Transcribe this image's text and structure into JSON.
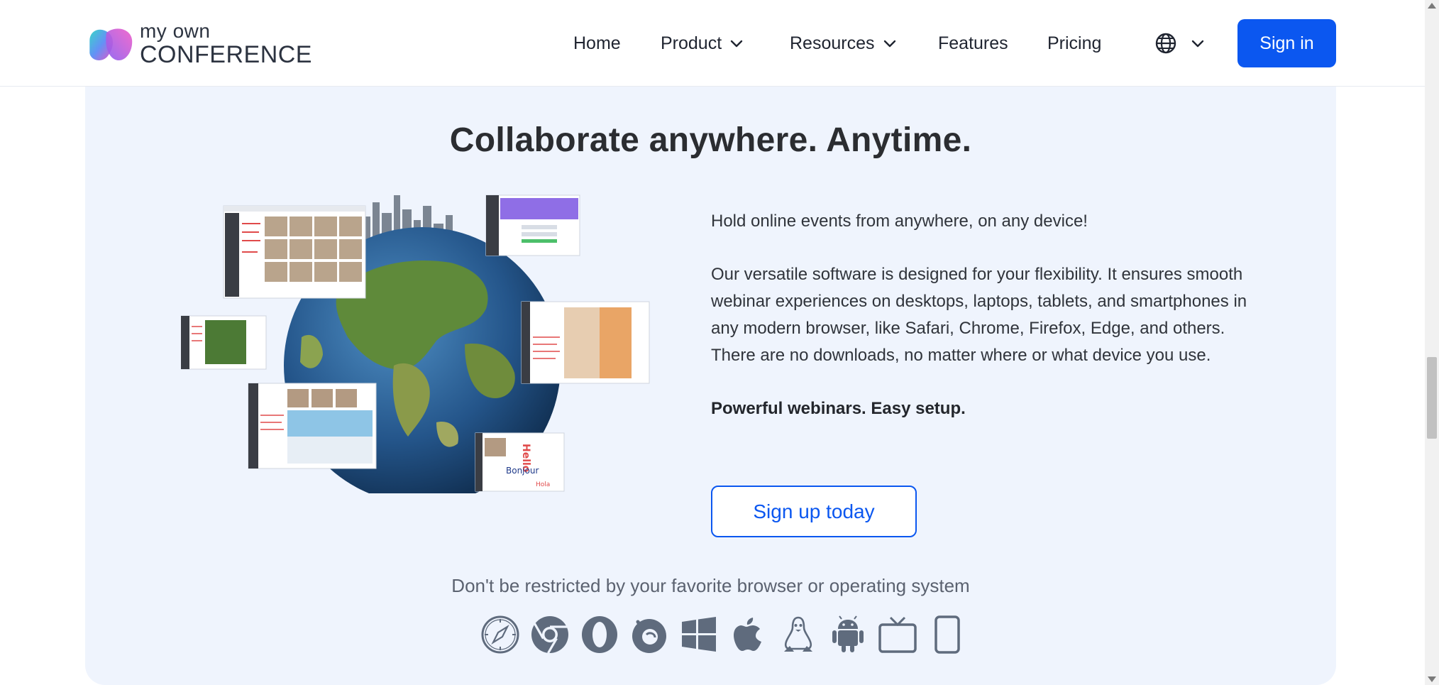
{
  "brand": {
    "logo_top": "my own",
    "logo_bottom": "CONFERENCE",
    "accent_color": "#0b57f0"
  },
  "nav": {
    "items": [
      {
        "label": "Home"
      },
      {
        "label": "Product"
      },
      {
        "label": "Resources"
      },
      {
        "label": "Features"
      },
      {
        "label": "Pricing"
      }
    ],
    "language_icon": "globe-icon",
    "signin_label": "Sign in"
  },
  "hero": {
    "headline": "Collaborate anywhere. Anytime.",
    "paragraph1": "Hold online events from anywhere, on any device!",
    "paragraph2": "Our versatile software is designed for your flexibility. It ensures smooth webinar experiences on desktops, laptops, tablets, and smartphones in any modern browser, like Safari, Chrome, Firefox, Edge, and others. There are no downloads, no matter where or what device you use.",
    "tagline": "Powerful webinars. Easy setup.",
    "cta_label": "Sign up today",
    "illustration_texts": [
      "Hello",
      "Bonjour",
      "Hola"
    ]
  },
  "platforms": {
    "caption": "Don't be restricted by your favorite browser or operating system",
    "icons": [
      "safari-icon",
      "chrome-icon",
      "opera-icon",
      "firefox-icon",
      "windows-icon",
      "apple-icon",
      "linux-icon",
      "android-icon",
      "tv-icon",
      "mobile-icon"
    ]
  }
}
